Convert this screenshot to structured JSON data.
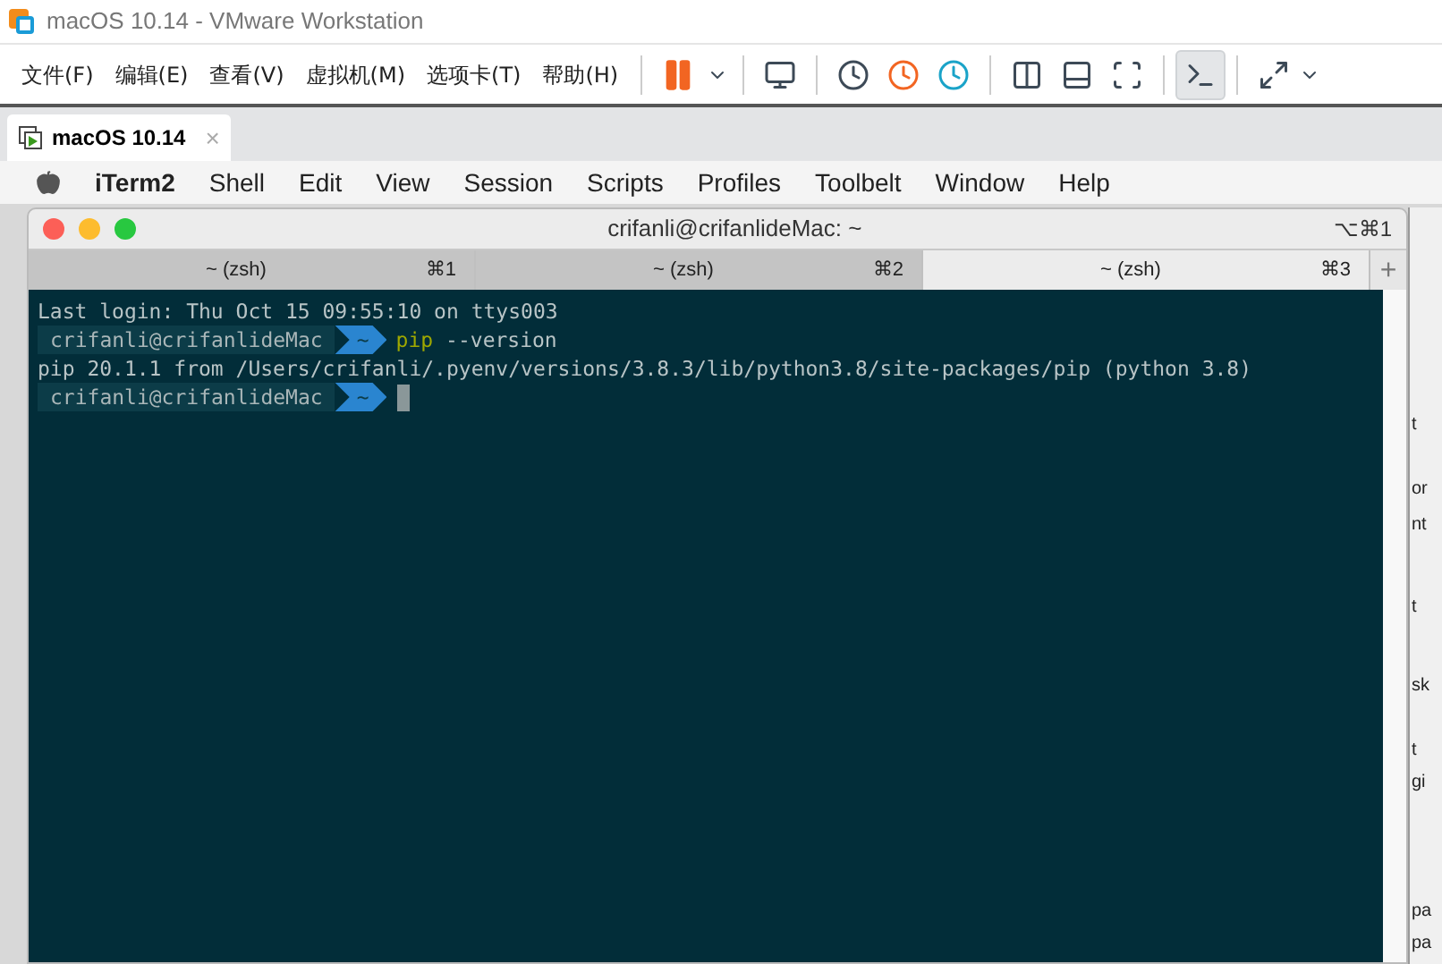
{
  "window": {
    "title": "macOS 10.14 - VMware Workstation"
  },
  "menu": [
    "文件(F)",
    "编辑(E)",
    "查看(V)",
    "虚拟机(M)",
    "选项卡(T)",
    "帮助(H)"
  ],
  "toolbar": [
    {
      "selected": false
    },
    {
      "selected": false
    },
    {
      "selected": false
    },
    {
      "selected": false
    },
    {
      "selected": false
    },
    {
      "selected": false
    },
    {
      "selected": false
    },
    {
      "selected": false
    },
    {
      "selected": false
    },
    {
      "selected": true
    },
    {
      "selected": false
    }
  ],
  "vm_tabs": [
    {
      "label": "macOS 10.14",
      "close": "×",
      "selected": true
    }
  ],
  "mac_menu": [
    "iTerm2",
    "Shell",
    "Edit",
    "View",
    "Session",
    "Scripts",
    "Profiles",
    "Toolbelt",
    "Window",
    "Help"
  ],
  "iterm": {
    "title": "crifanli@crifanlideMac: ~",
    "shortcut": "⌥⌘1",
    "tabs": [
      {
        "label": "~ (zsh)",
        "shortcut": "⌘1",
        "selected": false
      },
      {
        "label": "~ (zsh)",
        "shortcut": "⌘2",
        "selected": false
      },
      {
        "label": "~ (zsh)",
        "shortcut": "⌘3",
        "selected": true
      }
    ],
    "new_tab": "+",
    "lines": [
      {
        "kind": "text",
        "text": "Last login: Thu Oct 15 09:55:10 on ttys003"
      },
      {
        "kind": "prompt",
        "user": "crifanli@crifanlideMac",
        "dir": "~",
        "command": "pip",
        "args": "--version"
      },
      {
        "kind": "text",
        "text": "pip 20.1.1 from /Users/crifanli/.pyenv/versions/3.8.3/lib/python3.8/site-packages/pip (python 3.8)"
      },
      {
        "kind": "prompt",
        "user": "crifanli@crifanlideMac",
        "dir": "~",
        "cursor": true
      }
    ]
  },
  "background_window": {
    "fragments": [
      "t",
      "or",
      "nt",
      "t",
      "sk",
      "t",
      "gi",
      "pa",
      "pa"
    ]
  }
}
